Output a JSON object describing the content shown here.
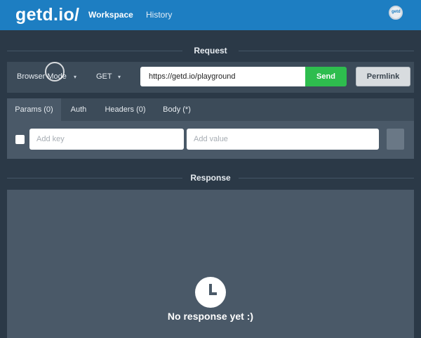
{
  "header": {
    "logo": "getd.io/",
    "nav": [
      "Workspace",
      "History"
    ],
    "avatar_text": "getd"
  },
  "request": {
    "section_title": "Request",
    "mode": "Browser Mode",
    "method": "GET",
    "url": "https://getd.io/playground",
    "send_label": "Send",
    "permlink_label": "Permlink"
  },
  "tabs": [
    {
      "label": "Params (0)",
      "active": true
    },
    {
      "label": "Auth",
      "active": false
    },
    {
      "label": "Headers (0)",
      "active": false
    },
    {
      "label": "Body (*)",
      "active": false
    }
  ],
  "params": {
    "key_placeholder": "Add key",
    "value_placeholder": "Add value"
  },
  "response": {
    "section_title": "Response",
    "empty_message": "No response yet :)"
  },
  "colors": {
    "header_bg": "#1d7ec2",
    "send_bg": "#2ebd4e",
    "page_bg": "#2b3947"
  },
  "icons": [
    "caret-down-icon",
    "clock-icon",
    "avatar-icon"
  ]
}
